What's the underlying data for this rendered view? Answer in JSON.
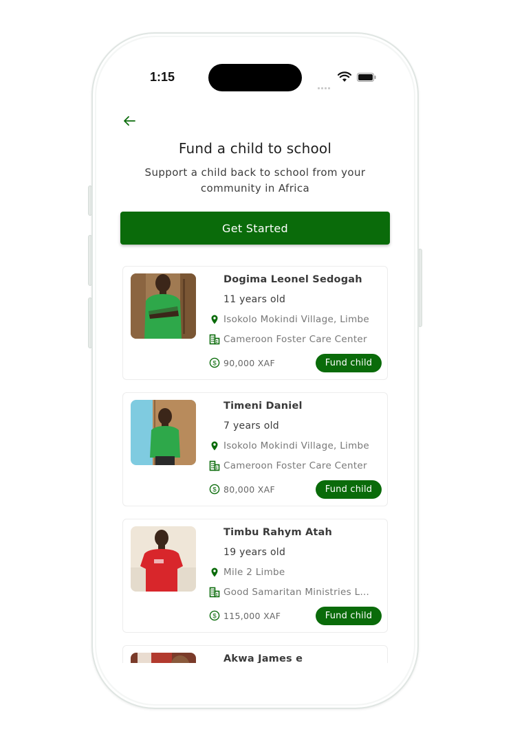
{
  "status_bar": {
    "time": "1:15"
  },
  "header": {
    "title": "Fund a child to school",
    "subtitle": "Support a child back to school from your community in Africa",
    "cta_label": "Get Started"
  },
  "icons": {
    "back": "arrow-left-icon",
    "location": "map-pin-icon",
    "organization": "building-icon",
    "amount": "dollar-circle-icon"
  },
  "colors": {
    "accent": "#0a6b0a",
    "photo_bg_1": "#a07a52",
    "photo_bg_2": "#7fcbe0",
    "photo_bg_3": "#efe6d8",
    "photo_bg_4": "#7a3b2a"
  },
  "children": [
    {
      "name": "Dogima Leonel Sedogah",
      "age": "11 years old",
      "location": "Isokolo Mokindi Village, Limbe",
      "organization": "Cameroon Foster Care Center",
      "amount": "90,000 XAF",
      "action": "Fund child"
    },
    {
      "name": "Timeni Daniel",
      "age": "7 years old",
      "location": "Isokolo Mokindi Village, Limbe",
      "organization": "Cameroon Foster Care Center",
      "amount": "80,000 XAF",
      "action": "Fund child"
    },
    {
      "name": "Timbu Rahym Atah",
      "age": "19 years old",
      "location": "Mile 2 Limbe",
      "organization": "Good Samaritan Ministries Limbe",
      "amount": "115,000 XAF",
      "action": "Fund child"
    },
    {
      "name": "Akwa James e"
    }
  ]
}
